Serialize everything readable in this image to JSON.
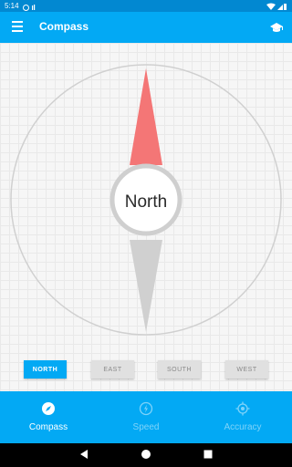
{
  "status_bar": {
    "time": "5:14"
  },
  "app_bar": {
    "title": "Compass",
    "menu_icon": "hamburger-menu-icon",
    "action_icon": "graduation-cap-icon"
  },
  "compass": {
    "heading_label": "North",
    "needle_north_color": "#f47676",
    "needle_south_color": "#d0d0d0"
  },
  "directions": {
    "buttons": [
      {
        "label": "NORTH",
        "active": true
      },
      {
        "label": "EAST",
        "active": false
      },
      {
        "label": "SOUTH",
        "active": false
      },
      {
        "label": "WEST",
        "active": false
      }
    ]
  },
  "bottom_nav": {
    "items": [
      {
        "label": "Compass",
        "icon": "compass-icon",
        "selected": true
      },
      {
        "label": "Speed",
        "icon": "speedometer-icon",
        "selected": false
      },
      {
        "label": "Accuracy",
        "icon": "gps-target-icon",
        "selected": false
      }
    ]
  },
  "colors": {
    "primary": "#03a9f4",
    "primary_dark": "#0288d1",
    "inactive_nav_text": "#7fd3f9"
  }
}
